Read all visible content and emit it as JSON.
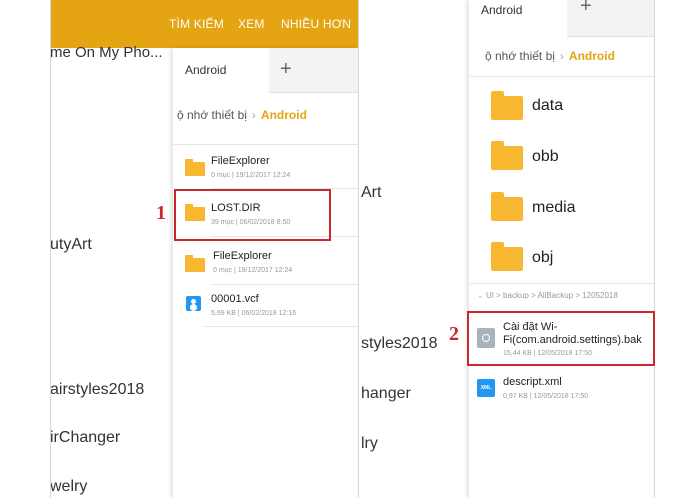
{
  "left": {
    "menu": {
      "search": "TÌM KIẾM",
      "view": "XEM",
      "more": "NHIỀU HƠN"
    },
    "background_items": [
      "me On My Pho...",
      "utyArt",
      "airstyles2018",
      "irChanger",
      "welry"
    ],
    "tab": "Android",
    "breadcrumb": {
      "root": "ộ nhớ thiết bị",
      "current": "Android"
    },
    "files": [
      {
        "name": "FileExplorer",
        "meta": "0 mục | 19/12/2017 12:24"
      },
      {
        "name": "LOST.DIR",
        "meta": "39 mục | 06/02/2018 8:50"
      },
      {
        "name": "FileExplorer",
        "meta": "0 mục | 19/12/2017 12:24"
      },
      {
        "name": "00001.vcf",
        "meta": "5,69 KB | 06/02/2018 12:16"
      }
    ],
    "marker": "1"
  },
  "right": {
    "tab": "Android",
    "background_items": [
      "Art",
      "styles2018",
      "hanger",
      "lry"
    ],
    "breadcrumb": {
      "root": "ộ nhớ thiết bị",
      "current": "Android"
    },
    "folders": [
      "data",
      "obb",
      "media",
      "obj"
    ],
    "path": "UI > backup > AllBackup > 12052018",
    "files": [
      {
        "name": "Cài đặt Wi-Fi(com.android.settings).bak",
        "meta": "15,44 KB | 12/05/2018 17:50"
      },
      {
        "name": "descript.xml",
        "meta": "0,97 KB | 12/05/2018 17:50"
      }
    ],
    "xml_icon_text": "XML",
    "marker": "2"
  },
  "colors": {
    "accent": "#e5a411",
    "folder": "#f7b731",
    "highlight": "#c8282e"
  }
}
